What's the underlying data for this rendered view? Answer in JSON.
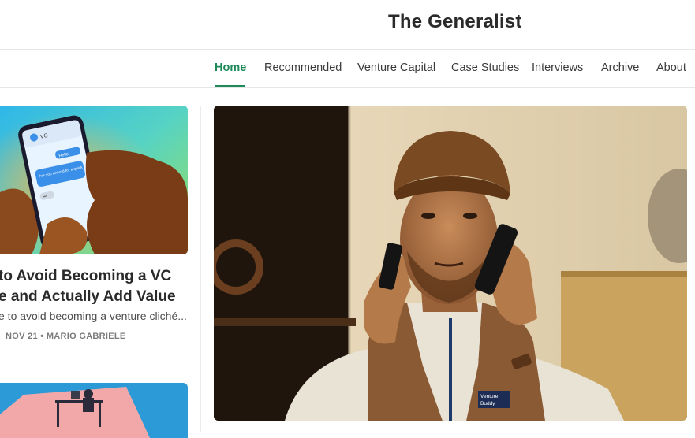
{
  "site": {
    "title": "The Generalist"
  },
  "nav": {
    "items": [
      {
        "label": "Home",
        "active": true
      },
      {
        "label": "Recommended"
      },
      {
        "label": "Venture Capital"
      },
      {
        "label": "Case Studies"
      },
      {
        "label": "Interviews"
      },
      {
        "label": "Archive"
      },
      {
        "label": "About"
      }
    ]
  },
  "featured_post": {
    "title_line1": "to Avoid Becoming a VC",
    "title_line2": "e and Actually Add Value",
    "subtitle": "e to avoid becoming a venture cliché...",
    "date": "NOV 21",
    "separator": "•",
    "author": "MARIO GABRIELE",
    "phone_header": "VC",
    "chat_bubble_1": "Hello!",
    "chat_bubble_2": "Are you around for a quick chat?",
    "chat_typing": "•••"
  },
  "hero": {
    "vest_patch_line1": "Venture",
    "vest_patch_line2": "Buddy"
  },
  "colors": {
    "accent": "#1e8a5a",
    "text": "#2a2a2a",
    "border": "#e6e6e6"
  }
}
